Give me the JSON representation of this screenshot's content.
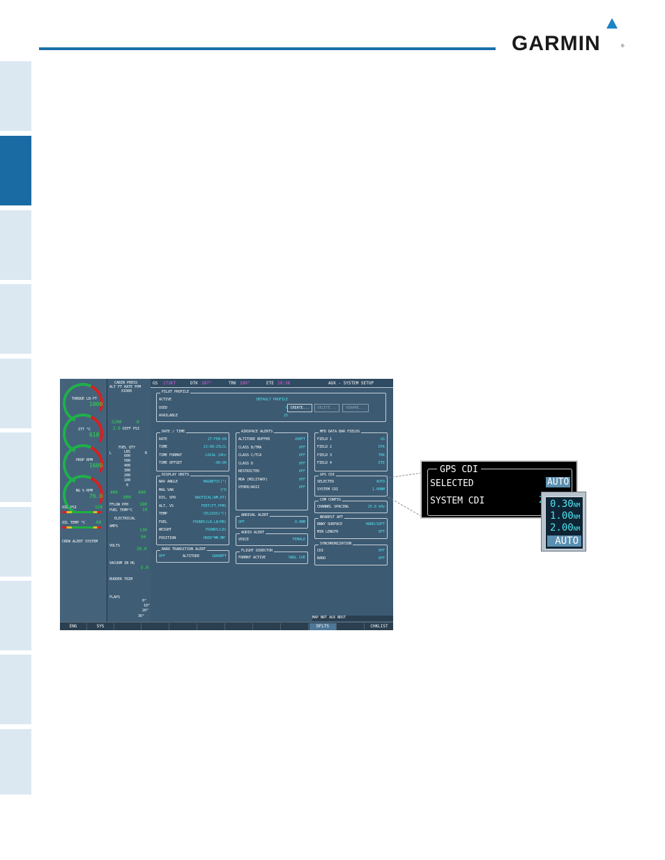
{
  "brand": {
    "logo_text": "GARMIN",
    "registered_mark": "®"
  },
  "screen": {
    "nav": {
      "gs_label": "GS",
      "gs_value": "172KT",
      "dtk_label": "DTK",
      "dtk_value": "287°",
      "trk_label": "TRK",
      "trk_value": "289°",
      "ete_label": "ETE",
      "ete_value": "19:38",
      "page_name": "AUX - SYSTEM SETUP"
    },
    "eis": {
      "torque_label": "TORQUE LB-FT",
      "torque_value": "1000",
      "itt_label": "ITT °C",
      "itt_value": "618",
      "prop_label": "PROP RPM",
      "prop_value": "1600",
      "ng_label": "NG % RPM",
      "ng_value": "76.0",
      "oil_psi_label": "OIL PSI",
      "oil_psi_value": "118",
      "oil_temp_label": "OIL TEMP °C",
      "oil_temp_value": "68",
      "crew_alert": "CREW ALERT SYSTEM"
    },
    "eis2": {
      "cabin_press": "CABIN PRESS",
      "alt_rate": "ALT FT  RATE FPM",
      "x1000": "X1000",
      "cabin_alt": "5200",
      "cabin_rate": "0",
      "diff_psi_label": "DIFF PSI",
      "diff_psi_value": "2.6",
      "fuel_qty": "FUEL QTY",
      "lbs": "LBS",
      "fuel_l": "L",
      "fuel_r": "R",
      "fuel_scale": [
        "600",
        "500",
        "400",
        "300",
        "200",
        "100",
        "0"
      ],
      "fuel_left": "400",
      "fuel_total": "800",
      "fuel_right": "400",
      "fflow_label": "FFLOW PPH",
      "fflow_value": "180",
      "fuel_temp_label": "FUEL TEMP°C",
      "fuel_temp_value": "10",
      "electrical": "ELECTRICAL",
      "amps_label": "AMPS",
      "amps_a": "130",
      "amps_b": "90",
      "volts_label": "VOLTS",
      "volts_value": "30.0",
      "vacuum_label": "VACUUM IN HG",
      "vacuum_value": "5.0",
      "rudder_trim": "RUDDER TRIM",
      "flaps": "FLAPS",
      "flap_settings": [
        "0°",
        "10°",
        "20°",
        "36°"
      ]
    },
    "pilot_profile": {
      "title": "PILOT PROFILE",
      "active_label": "ACTIVE",
      "active_value": "DEFAULT PROFILE",
      "used_label": "USED",
      "used_value": "0",
      "available_label": "AVAILABLE",
      "available_value": "25",
      "create": "CREATE...",
      "delete": "DELETE...",
      "rename": "RENAME..."
    },
    "date_time": {
      "title": "DATE / TIME",
      "date_label": "DATE",
      "date_value": "27-FEB-09",
      "time_label": "TIME",
      "time_value": "23:08:25LCL",
      "format_label": "TIME FORMAT",
      "format_value": "LOCAL 24hr",
      "offset_label": "TIME OFFSET",
      "offset_value": "-00:00"
    },
    "display_units": {
      "title": "DISPLAY UNITS",
      "nav_angle_label": "NAV ANGLE",
      "nav_angle_value": "MAGNETIC(°)",
      "mag_var_label": "MAG VAR",
      "mag_var_value": "3°E",
      "dis_spd_label": "DIS, SPD",
      "dis_spd_value": "NAUTICAL(NM,KT)",
      "alt_vs_label": "ALT, VS",
      "alt_vs_value": "FEET(FT,FPM)",
      "temp_label": "TEMP",
      "temp_value": "CELSIUS(°C)",
      "fuel_label": "FUEL",
      "fuel_value": "POUNDS(LB,LB/HR)",
      "weight_label": "WEIGHT",
      "weight_value": "POUNDS(LB)",
      "position_label": "POSITION",
      "position_value": "HDDD°MM.MM'"
    },
    "baro_alert": {
      "title": "BARO TRANSITION ALERT",
      "state": "OFF",
      "altitude_label": "ALTITUDE",
      "altitude_value": "18000FT"
    },
    "airspace_alerts": {
      "title": "AIRSPACE ALERTS",
      "rows": [
        {
          "k": "ALTITUDE BUFFER",
          "v": "200FT"
        },
        {
          "k": "CLASS B/TMA",
          "v": "OFF"
        },
        {
          "k": "CLASS C/TCA",
          "v": "OFF"
        },
        {
          "k": "CLASS D",
          "v": "OFF"
        },
        {
          "k": "RESTRICTED",
          "v": "OFF"
        },
        {
          "k": "MOA (MILITARY)",
          "v": "OFF"
        },
        {
          "k": "OTHER/ADIZ",
          "v": "OFF"
        }
      ]
    },
    "arrival_alert": {
      "title": "ARRIVAL ALERT",
      "state": "OFF",
      "value": "0.0NM"
    },
    "audio_alert": {
      "title": "AUDIO ALERT",
      "voice_label": "VOICE",
      "voice_value": "FEMALE"
    },
    "flight_director": {
      "title": "FLIGHT DIRECTOR",
      "format_label": "FORMAT ACTIVE",
      "format_value": "SNGL CUE"
    },
    "mfd_fields": {
      "title": "MFD DATA BAR FIELDS",
      "rows": [
        {
          "k": "FIELD 1",
          "v": "GS"
        },
        {
          "k": "FIELD 2",
          "v": "DTK"
        },
        {
          "k": "FIELD 3",
          "v": "TRK"
        },
        {
          "k": "FIELD 4",
          "v": "ETE"
        }
      ]
    },
    "gps_cdi_small": {
      "title": "GPS CDI",
      "selected_label": "SELECTED",
      "selected_value": "AUTO",
      "system_label": "SYSTEM CDI",
      "system_value": "1.00NM"
    },
    "com_config": {
      "title": "COM CONFIG",
      "spacing_label": "CHANNEL SPACING",
      "spacing_value": "25.0 kHz"
    },
    "nearest_apt": {
      "title": "NEAREST APT",
      "surface_label": "RNWY SURFACE",
      "surface_value": "HARD/SOFT",
      "length_label": "MIN LENGTH",
      "length_value": "0FT"
    },
    "sync": {
      "title": "SYNCHRONIZATION",
      "cdi_label": "CDI",
      "cdi_value": "OFF",
      "baro_label": "BARO",
      "baro_value": "OFF"
    },
    "mapbar": "MAP NRT AUX NRST",
    "softkeys": [
      "ENG",
      "SYS",
      "",
      "",
      "",
      "",
      "",
      "",
      "",
      "DFLTS",
      "",
      "CHKLIST"
    ]
  },
  "callout": {
    "title": "GPS CDI",
    "selected_label": "SELECTED",
    "selected_value": "AUTO",
    "system_label": "SYSTEM CDI",
    "system_value": "2"
  },
  "dropdown": {
    "options": [
      {
        "value": "0.30",
        "unit": "NM"
      },
      {
        "value": "1.00",
        "unit": "NM"
      },
      {
        "value": "2.00",
        "unit": "NM"
      },
      {
        "value": "AUTO",
        "unit": ""
      }
    ]
  }
}
